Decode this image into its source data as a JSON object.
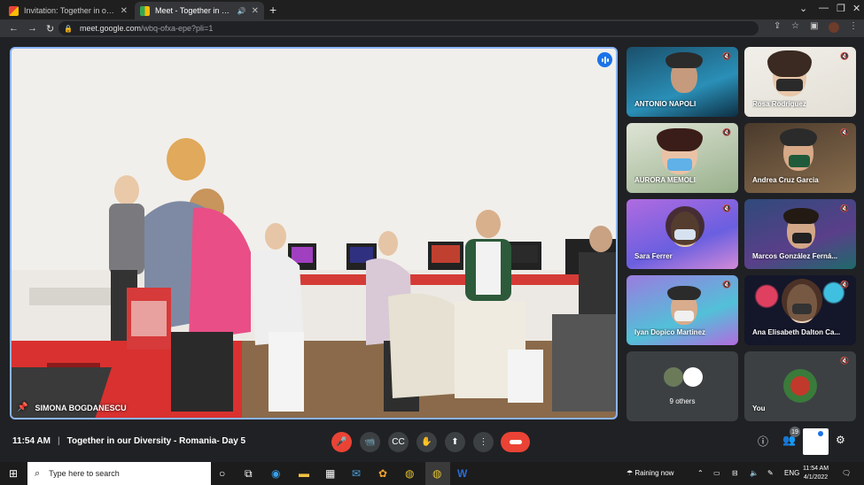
{
  "browser": {
    "tabs": [
      {
        "title": "Invitation: Together in our Diversity",
        "icon": "gmail-icon",
        "close": "✕"
      },
      {
        "title": "Meet - Together in our Diversity",
        "icon": "meet-icon",
        "close": "✕",
        "audio_icon": "🔊"
      }
    ],
    "new_tab": "+",
    "url_host": "meet.google.com",
    "url_path": "/wbq-ofxa-epe?pli=1"
  },
  "main_video": {
    "name": "SIMONA BOGDANESCU",
    "speaking_icon": "audio-level-icon"
  },
  "participants": [
    {
      "name": "ANTONIO NAPOLI"
    },
    {
      "name": "Rosa Rodriguez"
    },
    {
      "name": "AURORA MEMOLI"
    },
    {
      "name": "Andrea Cruz Garcia"
    },
    {
      "name": "Sara Ferrer"
    },
    {
      "name": "Marcos González Ferná..."
    },
    {
      "name": "Iyan Dopico Martinez"
    },
    {
      "name": "Ana Elisabeth Dalton Ca..."
    }
  ],
  "others_tile": {
    "label": "9 others"
  },
  "you_tile": {
    "label": "You"
  },
  "meeting": {
    "time": "11:54 AM",
    "separator": "|",
    "title": "Together in our Diversity - Romania- Day 5"
  },
  "people_badge": "19",
  "taskbar": {
    "search_placeholder": "Type here to search",
    "weather": "Raining now",
    "language": "ENG",
    "time": "11:54 AM",
    "date": "4/1/2022"
  },
  "colors": {
    "accent_blue": "#8ab4f8",
    "end_call_red": "#ea4335",
    "meet_bg": "#202124"
  }
}
